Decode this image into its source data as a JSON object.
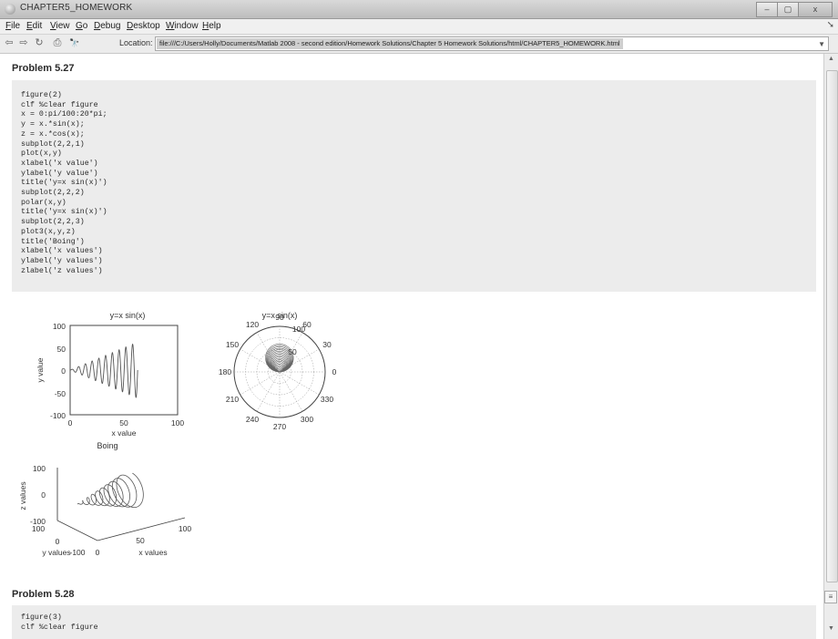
{
  "window": {
    "title": "CHAPTER5_HOMEWORK",
    "minimize": "–",
    "maximize": "▢",
    "close": "x"
  },
  "menu": {
    "items": [
      {
        "label": "File"
      },
      {
        "label": "Edit"
      },
      {
        "label": "View"
      },
      {
        "label": "Go"
      },
      {
        "label": "Debug"
      },
      {
        "label": "Desktop"
      },
      {
        "label": "Window"
      },
      {
        "label": "Help"
      }
    ],
    "overflow": "➘"
  },
  "toolbar": {
    "back_icon": "⇦",
    "forward_icon": "⇨",
    "refresh_icon": "↻",
    "print_icon": "⎙",
    "find_icon": "🔭",
    "location_label": "Location:",
    "location_value": "file:///C:/Users/Holly/Documents/Matlab 2008 - second edition/Homework Solutions/Chapter 5 Homework Solutions/html/CHAPTER5_HOMEWORK.html"
  },
  "problem1": {
    "heading": "Problem 5.27",
    "code": [
      "figure(2)",
      "clf %clear figure",
      "x = 0:pi/100:20*pi;",
      "y = x.*sin(x);",
      "z = x.*cos(x);",
      "subplot(2,2,1)",
      "plot(x,y)",
      "xlabel('x value')",
      "ylabel('y value')",
      "title('y=x sin(x)')",
      "subplot(2,2,2)",
      "polar(x,y)",
      "title('y=x sin(x)')",
      "subplot(2,2,3)",
      "plot3(x,y,z)",
      "title('Boing')",
      "xlabel('x values')",
      "ylabel('y values')",
      "zlabel('z values')"
    ]
  },
  "problem2": {
    "heading": "Problem 5.28",
    "code": [
      "figure(3)",
      "clf %clear figure"
    ]
  },
  "figure": {
    "plot1": {
      "title": "y=x sin(x)",
      "xlabel": "x value",
      "ylabel": "y value",
      "yticks": [
        "100",
        "50",
        "0",
        "-50",
        "-100"
      ],
      "xticks": [
        "0",
        "50",
        "100"
      ]
    },
    "polar": {
      "title": "y=x sin(x)",
      "angle_labels": [
        "90",
        "60",
        "30",
        "0",
        "330",
        "300",
        "270",
        "240",
        "210",
        "180",
        "150",
        "120"
      ],
      "radial_labels": [
        "50",
        "100"
      ]
    },
    "plot3": {
      "title": "Boing",
      "xlabel": "x values",
      "ylabel": "y values",
      "zlabel": "z values",
      "zticks": [
        "100",
        "0",
        "-100"
      ],
      "yticks": [
        "100",
        "0",
        "-100"
      ],
      "xticks": [
        "0",
        "50",
        "100"
      ]
    }
  }
}
